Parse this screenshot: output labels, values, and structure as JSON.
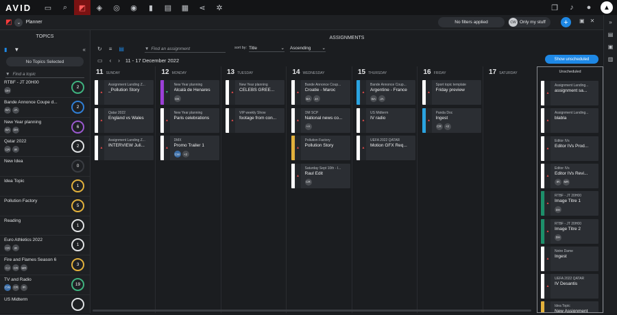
{
  "app": {
    "logo": "AVID"
  },
  "topbar": {
    "icons": [
      "folder-icon",
      "search-icon",
      "planner-icon",
      "hierarchy-icon",
      "stack-icon",
      "circle-icon",
      "bookmark-icon",
      "news-icon",
      "film-icon",
      "share-icon",
      "settings-icon"
    ],
    "right_icons": [
      "window-icon",
      "bell-icon",
      "user-icon"
    ]
  },
  "subbar": {
    "title": "Planner",
    "filters": "No filters applied",
    "only_my_initials": "CW",
    "only_my": "Only my stuff",
    "plus": "+"
  },
  "topics": {
    "title": "TOPICS",
    "no_selected": "No Topics Selected",
    "find_placeholder": "Find a topic",
    "items": [
      {
        "name": "RTBF - JT 20H00",
        "tags": [
          "DH"
        ],
        "count": "2",
        "ring": "#3fb37f"
      },
      {
        "name": "Bande Annonce Coupe d...",
        "tags": [
          "BA",
          "JA"
        ],
        "count": "2",
        "ring": "#2f7fd6"
      },
      {
        "name": "New Year planning",
        "tags": [
          "BA",
          "DH"
        ],
        "count": "6",
        "ring": "#9b59d0"
      },
      {
        "name": "Qatar 2022",
        "tags": [
          "CR",
          "IR"
        ],
        "count": "2",
        "ring": "#e0e2e4"
      },
      {
        "name": "New Idea",
        "tags": [],
        "count": "0",
        "ring": "#3a3d42"
      },
      {
        "name": "Idea Topic",
        "tags": [],
        "count": "1",
        "ring": "#e2b13c"
      },
      {
        "name": "Pollution Factory",
        "tags": [],
        "count": "5",
        "ring": "#e2b13c"
      },
      {
        "name": "Reading",
        "tags": [],
        "count": "1",
        "ring": "#e0e2e4"
      },
      {
        "name": "Euro Athletics 2022",
        "tags": [
          "CR",
          "IR"
        ],
        "count": "1",
        "ring": "#e0e2e4"
      },
      {
        "name": "Fire and Flames Season 6",
        "tags": [
          "CJ",
          "CR",
          "MR"
        ],
        "count": "3",
        "ring": "#e2b13c"
      },
      {
        "name": "TV and Radio",
        "tags": [
          "CW",
          "CR",
          "IR"
        ],
        "count": "19",
        "ring": "#3fb37f"
      },
      {
        "name": "US Midterm",
        "tags": [],
        "count": "",
        "ring": "#e0e2e4"
      }
    ]
  },
  "assignments": {
    "title": "ASSIGNMENTS",
    "find_placeholder": "Find an assignment",
    "sort_label": "sort by:",
    "sort_value": "Title",
    "order_value": "Ascending",
    "range": "11 - 17 December 2022",
    "show_unscheduled": "Show unscheduled",
    "unscheduled_title": "Unscheduled"
  },
  "days": [
    {
      "num": "11",
      "name": "SUNDAY",
      "cards": [
        {
          "topic": "Assignment Landing Z...",
          "name": "_Pollution Story",
          "bar": "#ffffff",
          "tags": []
        },
        {
          "topic": "Qatar 2022",
          "name": "England vs Wales",
          "bar": "#ffffff",
          "tags": []
        },
        {
          "topic": "Assignment Landing Z...",
          "name": "INTERVIEW Juli...",
          "bar": "#ffffff",
          "tags": []
        }
      ]
    },
    {
      "num": "12",
      "name": "MONDAY",
      "cards": [
        {
          "topic": "New Year planning",
          "name": "Alcalá de Henares",
          "bar": "#9b3fd6",
          "tags": [
            "DK"
          ],
          "green": true
        },
        {
          "topic": "New Year planning",
          "name": "Paris celebrations",
          "bar": "#ffffff",
          "tags": []
        },
        {
          "topic": "DMX",
          "name": "Promo Trailer 1",
          "bar": "#ffffff",
          "tags": [
            "CW",
            "+2"
          ]
        }
      ]
    },
    {
      "num": "13",
      "name": "TUESDAY",
      "cards": [
        {
          "topic": "New Year planning",
          "name": "CELEBS GREE...",
          "bar": "#ffffff",
          "tags": []
        },
        {
          "topic": "VIP weekly Show",
          "name": "footage from con...",
          "bar": "#ffffff",
          "tags": []
        }
      ]
    },
    {
      "num": "14",
      "name": "WEDNESDAY",
      "cards": [
        {
          "topic": "Bande Annonce Coup...",
          "name": "Croatie - Maroc",
          "bar": "#ffffff",
          "tags": [
            "BA",
            "JA"
          ]
        },
        {
          "topic": "OM SCP",
          "name": "National news co...",
          "bar": "#ffffff",
          "tags": [
            "+A"
          ]
        },
        {
          "topic": "Pollution Factory",
          "name": "Pollution Story",
          "bar": "#e2b13c",
          "tags": []
        },
        {
          "topic": "Saturday Sept 10th - I...",
          "name": "Raul Edit",
          "bar": "#ffffff",
          "tags": [
            "CR"
          ]
        }
      ]
    },
    {
      "num": "15",
      "name": "THURSDAY",
      "cards": [
        {
          "topic": "Bande Annonce Coup...",
          "name": "Argentine - France",
          "bar": "#2aa3e0",
          "tags": [
            "BA",
            "JA"
          ]
        },
        {
          "topic": "US Midterm",
          "name": "IV radio",
          "bar": "#ffffff",
          "tags": []
        },
        {
          "topic": "UEFA 2022 QATAR",
          "name": "Motion GFX Req...",
          "bar": "#ffffff",
          "tags": []
        }
      ]
    },
    {
      "num": "16",
      "name": "FRIDAY",
      "cards": [
        {
          "topic": "Sport topic template",
          "name": "Friday preview",
          "bar": "#ffffff",
          "tags": []
        },
        {
          "topic": "Panda Doc",
          "name": "Ingest",
          "bar": "#2aa3e0",
          "tags": [
            "CR",
            "+2"
          ]
        }
      ]
    },
    {
      "num": "17",
      "name": "SATURDAY",
      "cards": []
    }
  ],
  "unscheduled": [
    {
      "topic": "Assignment Landing...",
      "name": "assignment sa...",
      "bar": "#ffffff",
      "tags": []
    },
    {
      "topic": "Assignment Landing...",
      "name": "blabla",
      "bar": "#ffffff",
      "tags": []
    },
    {
      "topic": "Editor IVs",
      "name": "Editor IVs Prod...",
      "bar": "#ffffff",
      "tags": []
    },
    {
      "topic": "Editor IVs",
      "name": "Editor IVs Revi...",
      "bar": "#ffffff",
      "tags": [
        "IR",
        "MR"
      ]
    },
    {
      "topic": "RTBF - JT 20H00",
      "name": "Image Titre 1",
      "bar": "#1d8f6a",
      "tags": [
        "DH"
      ]
    },
    {
      "topic": "RTBF - JT 20H00",
      "name": "Image Titre 2",
      "bar": "#1d8f6a",
      "tags": [
        "DH"
      ]
    },
    {
      "topic": "Notre Dame",
      "name": "Ingest",
      "bar": "#ffffff",
      "tags": []
    },
    {
      "topic": "UEFA 2022 QATAR",
      "name": "IV Desantis",
      "bar": "#ffffff",
      "tags": []
    },
    {
      "topic": "Idea Topic",
      "name": "New Assignment",
      "bar": "#e2b13c",
      "tags": []
    }
  ]
}
